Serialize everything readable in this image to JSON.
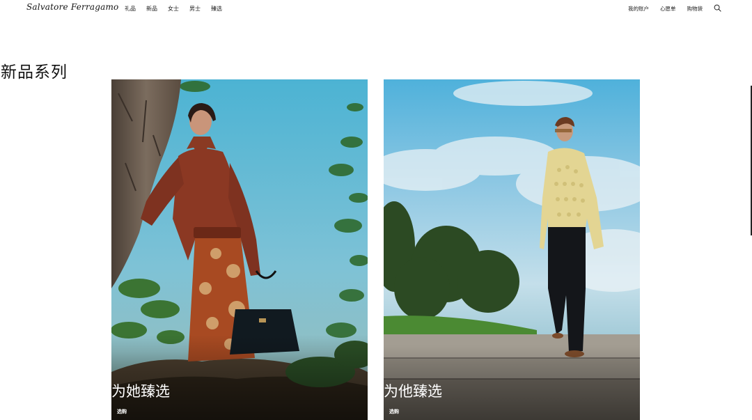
{
  "header": {
    "logo_text": "Salvatore Ferragamo",
    "nav": [
      {
        "label": "礼品"
      },
      {
        "label": "新品"
      },
      {
        "label": "女士"
      },
      {
        "label": "男士"
      },
      {
        "label": "臻选"
      }
    ],
    "utility": {
      "account": "我的账户",
      "wishlist": "心愿单",
      "bag": "购物袋"
    },
    "search_icon": "search-icon"
  },
  "main": {
    "section_title": "新品系列",
    "cards": [
      {
        "title": "为她臻选",
        "cta": "选购"
      },
      {
        "title": "为他臻选",
        "cta": "选购"
      }
    ]
  }
}
